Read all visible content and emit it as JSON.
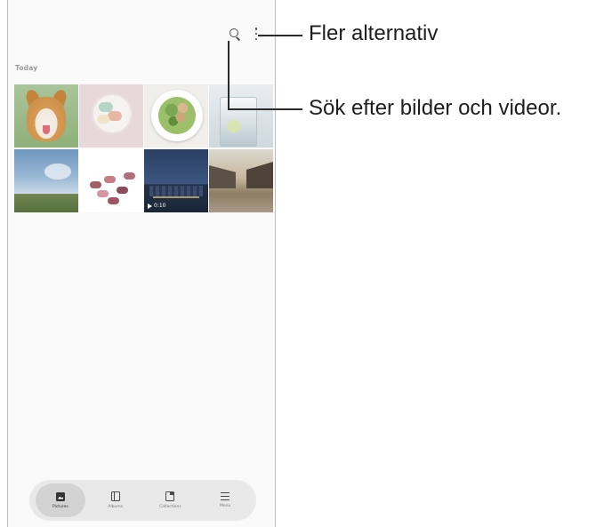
{
  "gallery": {
    "section_label": "Today",
    "video_duration": "0:10",
    "thumbnails": [
      {
        "name": "dog-photo"
      },
      {
        "name": "macaron-plate-photo"
      },
      {
        "name": "salad-photo"
      },
      {
        "name": "glass-drink-photo"
      },
      {
        "name": "sky-landscape-photo"
      },
      {
        "name": "macaron-stack-photo"
      },
      {
        "name": "city-night-video"
      },
      {
        "name": "old-street-photo"
      }
    ]
  },
  "toolbar": {
    "search_icon": "search-icon",
    "more_icon": "more-options-icon"
  },
  "bottom_nav": {
    "items": [
      {
        "label": "Pictures",
        "icon": "pictures-icon",
        "active": true
      },
      {
        "label": "Albums",
        "icon": "albums-icon",
        "active": false
      },
      {
        "label": "Collections",
        "icon": "collections-icon",
        "active": false
      },
      {
        "label": "Menu",
        "icon": "menu-icon",
        "active": false
      }
    ]
  },
  "callouts": {
    "more_options": "Fler alternativ",
    "search": "Sök efter bilder och videor."
  }
}
